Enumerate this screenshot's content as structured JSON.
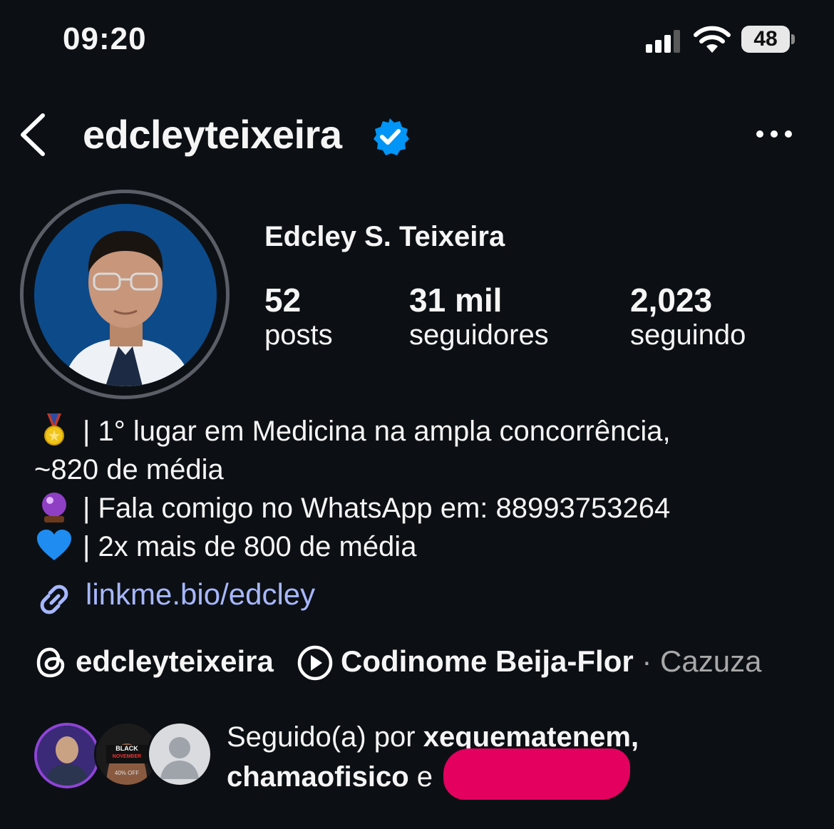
{
  "status_bar": {
    "time": "09:20",
    "battery": "48"
  },
  "header": {
    "username": "edcleyteixeira"
  },
  "profile": {
    "full_name": "Edcley S. Teixeira",
    "stats": [
      {
        "value": "52",
        "label": "posts"
      },
      {
        "value": "31 mil",
        "label": "seguidores"
      },
      {
        "value": "2,023",
        "label": "seguindo"
      }
    ]
  },
  "bio": {
    "lines": [
      {
        "emoji": "medal-icon",
        "text": "| 1° lugar em Medicina na ampla concorrência,"
      },
      {
        "emoji": "",
        "text": "~820 de média"
      },
      {
        "emoji": "crystal-ball-icon",
        "text": "| Fala comigo no WhatsApp em: 88993753264"
      },
      {
        "emoji": "blue-heart-icon",
        "text": "| 2x mais de 800 de média"
      }
    ],
    "link": "linkme.bio/edcley"
  },
  "threads": {
    "handle": "edcleyteixeira"
  },
  "music": {
    "song": "Codinome Beija-Flor",
    "separator": "·",
    "artist": "Cazuza"
  },
  "followed_by": {
    "prefix": "Seguido(a) por",
    "user1": "xequematenem,",
    "user2": "chamaofisico",
    "connector": "e",
    "badge_text_1": "BLACK",
    "badge_text_2": "NOVEMBER",
    "badge_text_3": "40% OFF"
  },
  "colors": {
    "background": "#0c1014",
    "verified": "#0095f6",
    "link": "#a7b7ff",
    "redaction": "#e3005f"
  }
}
